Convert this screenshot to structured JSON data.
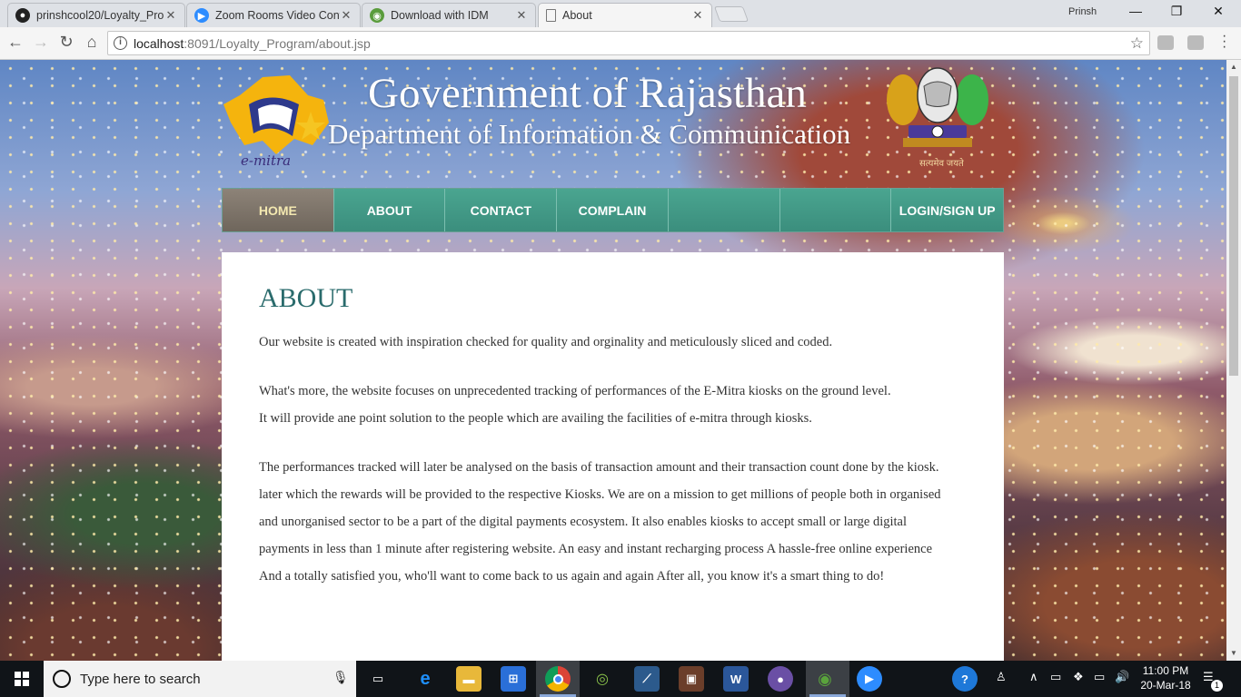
{
  "browser": {
    "tabs": [
      {
        "title": "prinshcool20/Loyalty_Pro",
        "icon": "github-icon"
      },
      {
        "title": "Zoom Rooms Video Conf",
        "icon": "zoom-icon"
      },
      {
        "title": "Download with IDM",
        "icon": "idm-icon"
      },
      {
        "title": "About",
        "icon": "page-icon"
      }
    ],
    "active_tab": 3,
    "profile_name": "Prinsh",
    "url_host": "localhost",
    "url_rest": ":8091/Loyalty_Program/about.jsp"
  },
  "header": {
    "logo_text": "e-mitra",
    "title": "Government of Rajasthan",
    "subtitle": "Department of Information & Communication",
    "emblem_caption": "सत्यमेव जयते"
  },
  "nav": {
    "items": [
      "HOME",
      "ABOUT",
      "CONTACT",
      "COMPLAIN",
      "",
      "",
      "LOGIN/SIGN UP"
    ],
    "active": "HOME"
  },
  "content": {
    "heading": "ABOUT",
    "lines": [
      "Our website is created with inspiration checked for quality and orginality and meticulously sliced and coded.",
      "What's more, the website focuses on unprecedented tracking of performances of the E-Mitra kiosks on the ground level.",
      "It will provide ane point solution to the people which are availing the facilities of e-mitra through kiosks.",
      "The performances tracked will later be analysed on the basis of transaction amount and their transaction count done by the kiosk.",
      "later which the rewards will be provided to the respective Kiosks. We are on a mission to get millions of people both in organised",
      "and unorganised sector to be a part of the digital payments ecosystem. It also enables kiosks to accept small or large digital",
      "payments in less than 1 minute after registering website. An easy and instant recharging process A hassle-free online experience",
      "And a totally satisfied you, who'll want to come back to us again and again After all, you know it's a smart thing to do!"
    ]
  },
  "taskbar": {
    "search_placeholder": "Type here to search",
    "time": "11:00 PM",
    "date": "20-Mar-18",
    "notification_count": "1"
  },
  "colors": {
    "nav_teal": "#3f9a87",
    "nav_active": "#7c7268",
    "heading": "#2a6b6c"
  }
}
